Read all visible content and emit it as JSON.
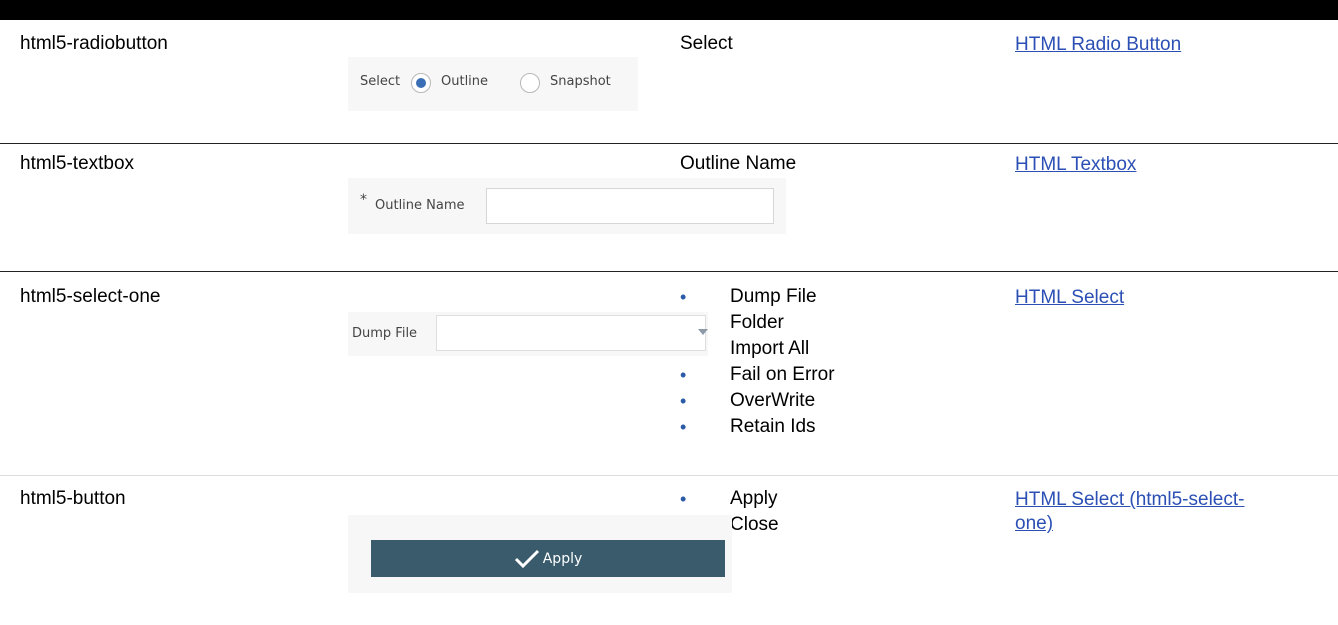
{
  "rows": [
    {
      "component": "html5-radiobutton",
      "labels": [
        "Select"
      ],
      "link": "HTML Radio Button",
      "snapshot": {
        "label": "Select",
        "options": [
          "Outline",
          "Snapshot"
        ],
        "selected": "Outline"
      }
    },
    {
      "component": "html5-textbox",
      "labels": [
        "Outline Name"
      ],
      "link": "HTML Textbox",
      "snapshot": {
        "required_marker": "*",
        "label": "Outline Name",
        "value": ""
      }
    },
    {
      "component": "html5-select-one",
      "labels": [
        "Dump File",
        "Folder",
        "Import All",
        "Fail on Error",
        "OverWrite",
        "Retain Ids"
      ],
      "link": "HTML Select",
      "snapshot": {
        "label": "Dump File",
        "value": ""
      }
    },
    {
      "component": "html5-button",
      "labels": [
        "Apply",
        "Close"
      ],
      "link": "HTML Select (html5-select-one)",
      "link_line1": "HTML Select (html5-select-",
      "link_line2": "one)",
      "snapshot": {
        "button_label": "Apply",
        "icon": "checkmark-icon"
      }
    }
  ],
  "colors": {
    "link": "#2b4fb4",
    "bullet": "#2b5aa6",
    "button": "#395b6c",
    "radio_selected": "#3a6fb6"
  }
}
